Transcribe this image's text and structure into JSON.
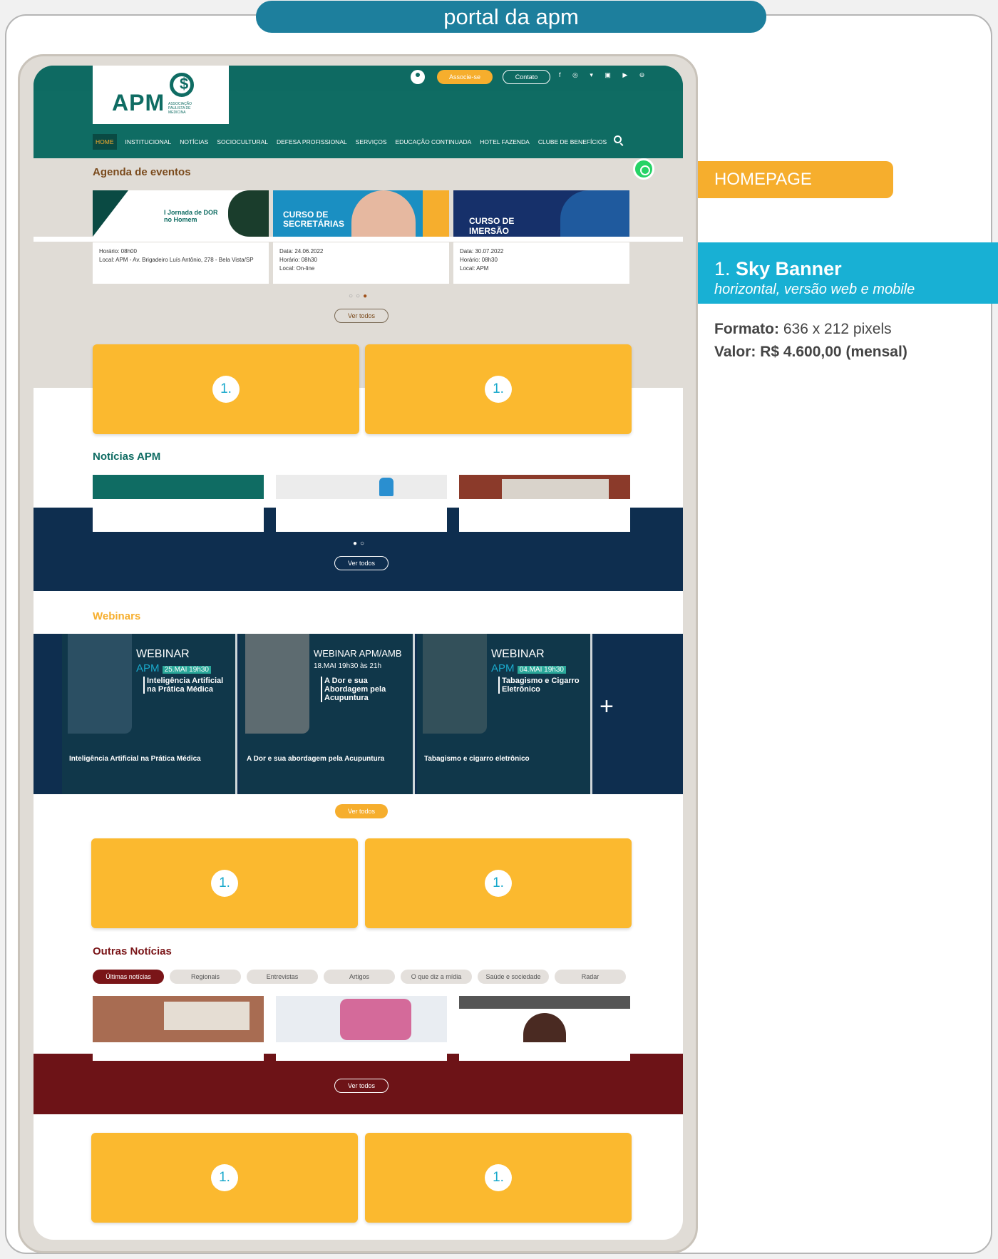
{
  "header_title": "portal da apm",
  "side": {
    "section": "HOMEPAGE",
    "ad_num": "1.",
    "ad_name": "Sky Banner",
    "ad_desc": "horizontal, versão web e mobile",
    "formato_label": "Formato:",
    "formato_value": "636 x 212 pixels",
    "valor_label": "Valor: R$ 4.600,00 (mensal)"
  },
  "site": {
    "logo": "APM",
    "logo_sub": "ASSOCIAÇÃO PAULISTA DE MEDICINA",
    "associe": "Associe-se",
    "contato": "Contato",
    "nav": [
      "HOME",
      "INSTITUCIONAL",
      "NOTÍCIAS",
      "SOCIOCULTURAL",
      "DEFESA PROFISSIONAL",
      "SERVIÇOS",
      "EDUCAÇÃO CONTINUADA",
      "HOTEL FAZENDA",
      "CLUBE DE BENEFÍCIOS"
    ],
    "agenda_title": "Agenda de eventos",
    "events": [
      {
        "img_text": "I Jornada de DOR no Homem",
        "line1": "Horário: 08h00",
        "line2": "Local: APM - Av. Brigadeiro Luís Antônio, 278 - Bela Vista/SP",
        "line3": ""
      },
      {
        "img_text": "CURSO DE SECRETÁRIAS",
        "line1": "Data: 24.06.2022",
        "line2": "Horário: 08h30",
        "line3": "Local: On-line"
      },
      {
        "img_text": "CURSO DE IMERSÃO",
        "line1": "Data: 30.07.2022",
        "line2": "Horário: 08h30",
        "line3": "Local: APM"
      }
    ],
    "ver_todos": "Ver todos",
    "ad_label": "1.",
    "noticias_title": "Notícias APM",
    "webinars_title": "Webinars",
    "webinars": [
      {
        "title": "WEBINAR",
        "sub": "APM",
        "date": "25.MAI 19h30",
        "topic": "Inteligência Artificial na Prática Médica",
        "caption": "Inteligência Artificial na Prática Médica"
      },
      {
        "title": "WEBINAR APM/AMB",
        "sub": "",
        "date": "18.MAI 19h30 às 21h",
        "topic": "A Dor e sua Abordagem pela Acupuntura",
        "caption": "A Dor e sua abordagem pela Acupuntura"
      },
      {
        "title": "WEBINAR",
        "sub": "APM",
        "date": "04.MAI 19h30",
        "topic": "Tabagismo e Cigarro Eletrônico",
        "caption": "Tabagismo e cigarro eletrônico"
      }
    ],
    "outras_title": "Outras Notícias",
    "tabs": [
      "Últimas notícias",
      "Regionais",
      "Entrevistas",
      "Artigos",
      "O que diz a mídia",
      "Saúde e sociedade",
      "Radar"
    ]
  }
}
